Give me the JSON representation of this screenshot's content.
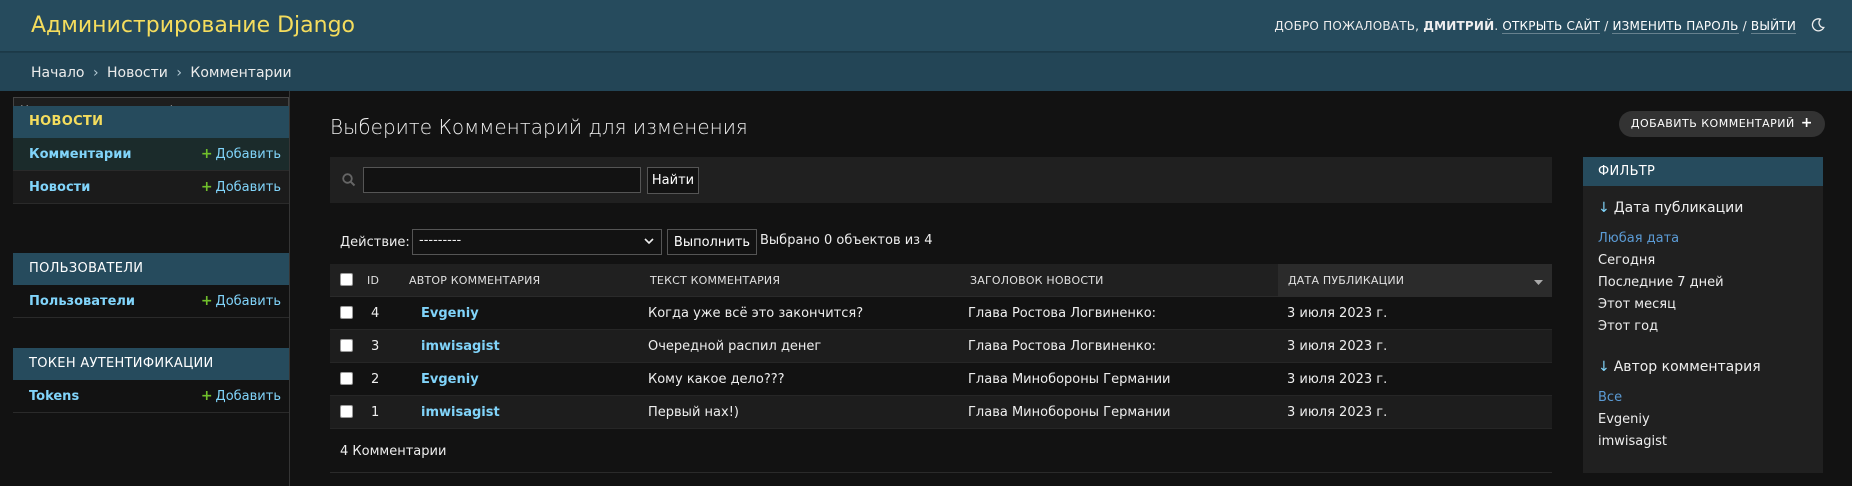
{
  "header": {
    "brand": "Администрирование Django",
    "welcome": "ДОБРО ПОЖАЛОВАТЬ,",
    "username": "ДМИТРИЙ",
    "view_site": "ОТКРЫТЬ САЙТ",
    "change_password": "ИЗМЕНИТЬ ПАРОЛЬ",
    "logout": "ВЫЙТИ",
    "separator": "/"
  },
  "breadcrumbs": {
    "home": "Начало",
    "app": "Новости",
    "current": "Комментарии",
    "sep": "›"
  },
  "sidebar": {
    "filter_placeholder": "Начните печатать для фильтрации...",
    "add_label": "Добавить",
    "apps": [
      {
        "caption": "НОВОСТИ",
        "models": [
          {
            "name": "Комментарии"
          },
          {
            "name": "Новости"
          }
        ]
      },
      {
        "caption": "ПОЛЬЗОВАТЕЛИ",
        "models": [
          {
            "name": "Пользователи"
          }
        ]
      },
      {
        "caption": "ТОКЕН АУТЕНТИФИКАЦИИ",
        "models": [
          {
            "name": "Tokens"
          }
        ]
      }
    ]
  },
  "content": {
    "title": "Выберите Комментарий для изменения",
    "add_button": "ДОБАВИТЬ КОММЕНТАРИЙ",
    "search_button": "Найти",
    "search_value": "",
    "action_label": "Действие:",
    "action_selected": "---------",
    "action_go": "Выполнить",
    "action_counter": "Выбрано 0 объектов из 4"
  },
  "table": {
    "columns": [
      "ID",
      "АВТОР КОММЕНТАРИЯ",
      "ТЕКСТ КОММЕНТАРИЯ",
      "ЗАГОЛОВОК НОВОСТИ",
      "ДАТА ПУБЛИКАЦИИ"
    ],
    "rows": [
      {
        "id": "4",
        "author": "Evgeniy",
        "text": "Когда уже всё это закончится?",
        "news": "Глава Ростова Логвиненко:",
        "date": "3 июля 2023 г."
      },
      {
        "id": "3",
        "author": "imwisagist",
        "text": "Очередной распил денег",
        "news": "Глава Ростова Логвиненко:",
        "date": "3 июля 2023 г."
      },
      {
        "id": "2",
        "author": "Evgeniy",
        "text": "Кому какое дело???",
        "news": "Глава Минобороны Германии",
        "date": "3 июля 2023 г."
      },
      {
        "id": "1",
        "author": "imwisagist",
        "text": "Первый нах!)",
        "news": "Глава Минобороны Германии",
        "date": "3 июля 2023 г."
      }
    ],
    "paginator": "4 Комментарии"
  },
  "filter": {
    "title": "ФИЛЬТР",
    "groups": [
      {
        "heading": "Дата публикации",
        "options": [
          "Любая дата",
          "Сегодня",
          "Последние 7 дней",
          "Этот месяц",
          "Этот год"
        ]
      },
      {
        "heading": "Автор комментария",
        "options": [
          "Все",
          "Evgeniy",
          "imwisagist"
        ]
      }
    ],
    "arrow": "↓"
  },
  "colors": {
    "header_bg": "#264b5d",
    "brand": "#f5dd5d",
    "link": "#81d4fa",
    "add_plus": "#70bf2b",
    "page_bg": "#121212"
  },
  "icons": {
    "theme_toggle": "moon-icon",
    "search": "search-icon",
    "add": "plus-icon",
    "sort": "sort-descending-icon"
  }
}
